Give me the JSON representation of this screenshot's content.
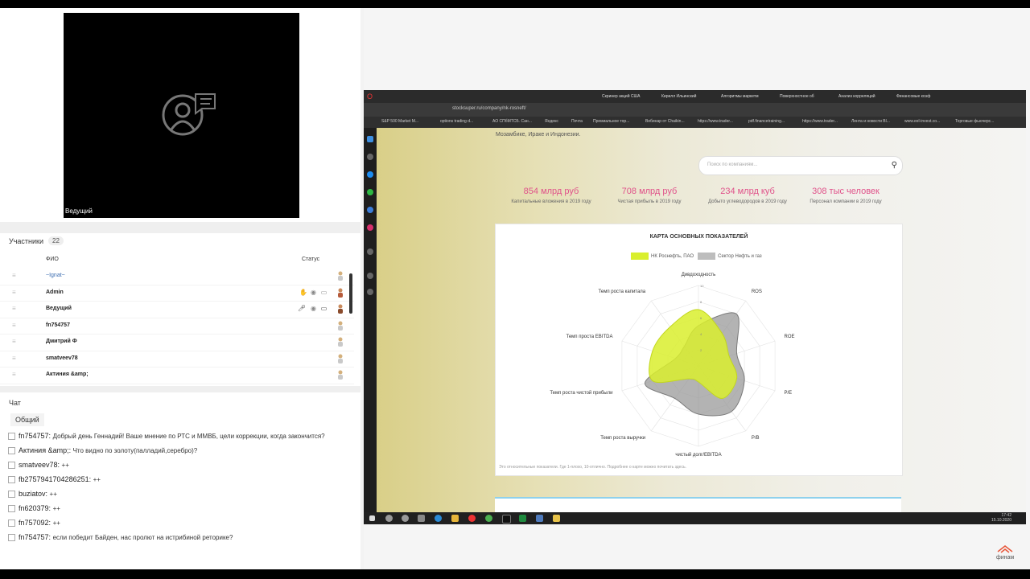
{
  "video": {
    "label": "Ведущий"
  },
  "participants": {
    "title": "Участники",
    "count": "22",
    "col_name": "ФИО",
    "col_status": "Статус",
    "rows": [
      "~Ignat~",
      "Admin",
      "Ведущий",
      "fn754757",
      "Дмитрий Ф",
      "smatveev78",
      "Актиния &amp;"
    ]
  },
  "chat": {
    "title": "Чат",
    "tab": "Общий",
    "messages": [
      {
        "who": "fn754757:",
        "text": "Добрый день Геннадий! Ваше мнение по РТС и ММВБ, цели коррекции, когда закончится?"
      },
      {
        "who": "Актиния &amp;:",
        "text": "Что видно по золоту(палладий,серебро)?"
      },
      {
        "who": "smatveev78:",
        "text": "++"
      },
      {
        "who": "fb2757941704286251:",
        "text": "++"
      },
      {
        "who": "buziatov:",
        "text": "++"
      },
      {
        "who": "fn620379:",
        "text": "++"
      },
      {
        "who": "fn757092:",
        "text": "++"
      },
      {
        "who": "fn754757:",
        "text": "если победит Байден, нас пролют на истрибиной реторике?"
      }
    ]
  },
  "browser": {
    "url": "stocksuper.ru/company/nk-rosneft/",
    "tabs": [
      "Скринер акций США",
      "Кирилл Ильинский",
      "Алгоритмы маркетм",
      "Поверхностное об",
      "Анализ корреляций",
      "Финансовые коэф"
    ],
    "bookmarks": [
      "S&P 500 Market M...",
      "options trading d...",
      "АО СПбМТСБ. Сан...",
      "Яндекс",
      "Почта",
      "Премиальное тор...",
      "Вебинар от Chaikin...",
      "https://www.trader...",
      "pdf.financetraining...",
      "https://www.trader...",
      "Лента и новости Bl...",
      "www.eel-invest.co...",
      "Торговые фьючерс..."
    ]
  },
  "page": {
    "intro": "Мозамбике, Ираке и Индонезии.",
    "search_placeholder": "Поиск по компаниям...",
    "stats": [
      {
        "value": "854 млрд руб",
        "label": "Капитальные вложения в 2019 году"
      },
      {
        "value": "708 млрд руб",
        "label": "Чистая прибыль в 2019 году"
      },
      {
        "value": "234 млрд куб",
        "label": "Добыто углеводородов в 2019 году"
      },
      {
        "value": "308 тыс человек",
        "label": "Персонал компании в 2019 году"
      }
    ],
    "card_title": "КАРТА ОСНОВНЫХ ПОКАЗАТЕЛЕЙ",
    "footnote": "Это относительные показатели. Где 1-плохо, 10-отлично. Подробнее о карте можно почитать здесь.",
    "clock_time": "17:42",
    "clock_date": "15.10.2020"
  },
  "chart_data": {
    "type": "radar",
    "title": "КАРТА ОСНОВНЫХ ПОКАЗАТЕЛЕЙ",
    "axes": [
      "Дивдоходность",
      "ROS",
      "ROE",
      "P/E",
      "P/B",
      "чистый долг/EBITDA",
      "Темп роста выручки",
      "Темп роста чистой прибыли",
      "Темп проста EBITDA",
      "Темп роста капитала"
    ],
    "rmax": 10,
    "series": [
      {
        "name": "НК Роснефть, ПАО",
        "color": "#d9ef2e",
        "values": [
          7,
          5,
          4,
          5,
          5,
          2,
          2,
          6,
          6,
          6
        ]
      },
      {
        "name": "Сектор Нефть и газ",
        "color": "#9a9a9a",
        "values": [
          5,
          8,
          5,
          6,
          7,
          6,
          5,
          7,
          3,
          3
        ]
      }
    ]
  },
  "logo": "финам"
}
